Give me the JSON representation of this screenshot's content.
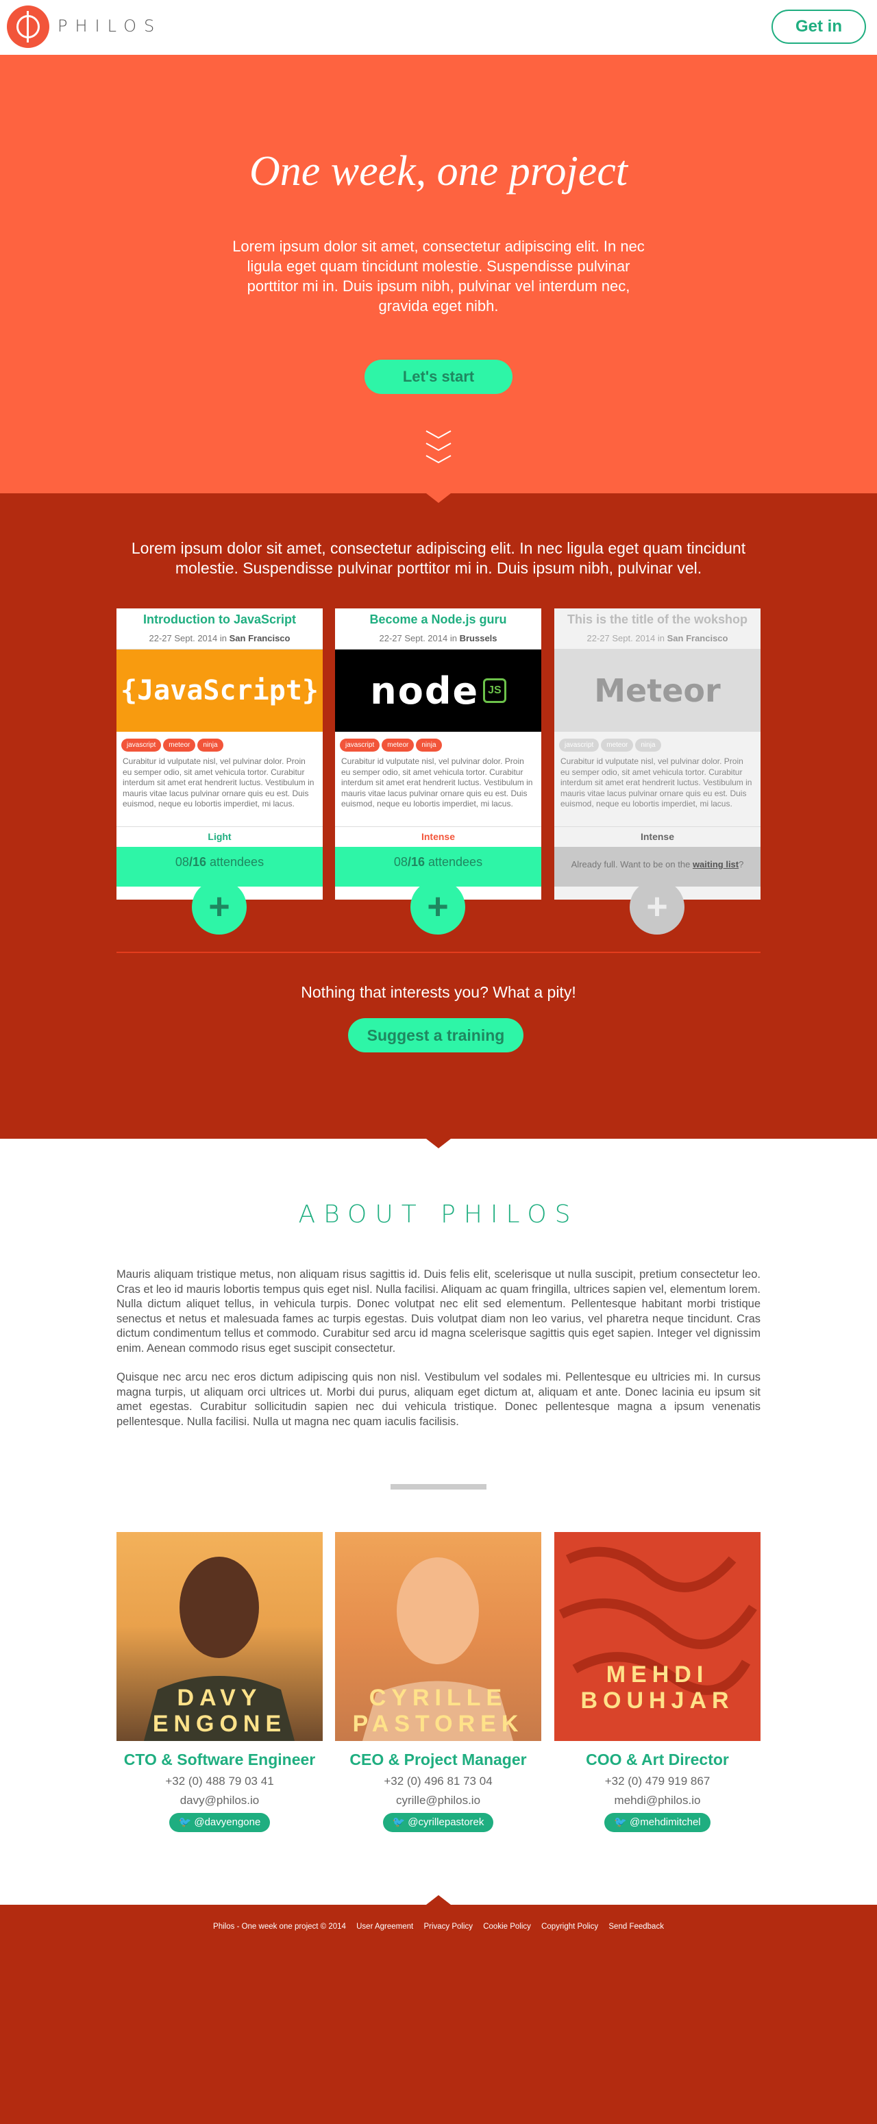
{
  "header": {
    "logo_text": "PHILOS",
    "cta": "Get in"
  },
  "hero": {
    "title": "One week, one project",
    "text": "Lorem ipsum dolor sit amet, consectetur adipiscing elit. In nec ligula eget quam tincidunt molestie. Suspendisse pulvinar porttitor mi in. Duis ipsum nibh, pulvinar vel interdum nec, gravida eget nibh.",
    "button": "Let's start"
  },
  "workshops": {
    "intro": "Lorem ipsum dolor sit amet, consectetur adipiscing elit. In nec ligula eget quam tincidunt molestie. Suspendisse pulvinar porttitor mi in. Duis ipsum nibh, pulvinar vel.",
    "cards": [
      {
        "title": "Introduction to JavaScript",
        "date": "22-27 Sept. 2014 in",
        "city": "San Francisco",
        "banner": "{JavaScript}",
        "tags": [
          "javascript",
          "meteor",
          "ninja"
        ],
        "desc": "Curabitur id vulputate nisl, vel pulvinar dolor. Proin eu semper odio, sit amet vehicula tortor. Curabitur interdum sit amet erat hendrerit luctus. Vestibulum in mauris vitae lacus pulvinar ornare quis eu est. Duis euismod, neque eu lobortis imperdiet, mi lacus.",
        "level": "Light",
        "level_color": "#1fae80",
        "count": "08",
        "total": "16",
        "attendees": " attendees",
        "plus": "+"
      },
      {
        "title": "Become a Node.js guru",
        "date": "22-27 Sept. 2014 in",
        "city": "Brussels",
        "banner": "node",
        "banner_badge": "JS",
        "tags": [
          "javascript",
          "meteor",
          "ninja"
        ],
        "desc": "Curabitur id vulputate nisl, vel pulvinar dolor. Proin eu semper odio, sit amet vehicula tortor. Curabitur interdum sit amet erat hendrerit luctus. Vestibulum in mauris vitae lacus pulvinar ornare quis eu est. Duis euismod, neque eu lobortis imperdiet, mi lacus.",
        "level": "Intense",
        "level_color": "#f2553a",
        "count": "08",
        "total": "16",
        "attendees": " attendees",
        "plus": "+"
      },
      {
        "title": "This is the title of the wokshop",
        "date": "22-27 Sept. 2014 in",
        "city": "San Francisco",
        "banner": "Meteor",
        "tags": [
          "javascript",
          "meteor",
          "ninja"
        ],
        "desc": "Curabitur id vulputate nisl, vel pulvinar dolor. Proin eu semper odio, sit amet vehicula tortor. Curabitur interdum sit amet erat hendrerit luctus. Vestibulum in mauris vitae lacus pulvinar ornare quis eu est. Duis euismod, neque eu lobortis imperdiet, mi lacus.",
        "level": "Intense",
        "full_text": "Already full.  Want to be on the ",
        "waiting_link": "waiting list",
        "full_end": "?",
        "plus": "+"
      }
    ],
    "pity": "Nothing that interests you? What a pity!",
    "suggest": "Suggest a training"
  },
  "about": {
    "title": "ABOUT PHILOS",
    "p1": "Mauris aliquam tristique metus, non aliquam risus sagittis id. Duis felis elit, scelerisque ut nulla suscipit, pretium consectetur leo. Cras et leo id mauris lobortis tempus quis eget nisl. Nulla facilisi. Aliquam ac quam fringilla, ultrices sapien vel, elementum lorem. Nulla dictum aliquet tellus, in vehicula turpis. Donec volutpat nec elit sed elementum. Pellentesque habitant morbi tristique senectus et netus et malesuada fames ac turpis egestas. Duis volutpat diam non leo varius, vel pharetra neque tincidunt. Cras dictum condimentum tellus et commodo. Curabitur sed arcu id magna scelerisque sagittis quis eget sapien. Integer vel dignissim enim. Aenean commodo risus eget suscipit consectetur.",
    "p2": "Quisque nec arcu nec eros dictum adipiscing quis non nisl. Vestibulum vel sodales mi. Pellentesque eu ultricies mi. In cursus magna turpis, ut aliquam orci ultrices ut. Morbi dui purus, aliquam eget dictum at, aliquam et ante. Donec lacinia eu ipsum sit amet egestas. Curabitur sollicitudin sapien nec dui vehicula tristique. Donec pellentesque magna a ipsum venenatis pellentesque. Nulla facilisi. Nulla ut magna nec quam iaculis facilisis."
  },
  "team": [
    {
      "first": "DAVY",
      "last": "ENGONE",
      "role": "CTO & Software Engineer",
      "phone": "+32 (0) 488 79 03 41",
      "email": "davy@philos.io",
      "twitter": "@davyengone"
    },
    {
      "first": "CYRILLE",
      "last": "PASTOREK",
      "role": "CEO & Project Manager",
      "phone": "+32 (0) 496 81 73 04",
      "email": "cyrille@philos.io",
      "twitter": "@cyrillepastorek"
    },
    {
      "first": "MEHDI",
      "last": "BOUHJAR",
      "role": "COO & Art Director",
      "phone": "+32 (0) 479 919 867",
      "email": "mehdi@philos.io",
      "twitter": "@mehdimitchel"
    }
  ],
  "footer": {
    "copyright": "Philos - One week one project © 2014",
    "links": [
      "User Agreement",
      "Privacy Policy",
      "Cookie Policy",
      "Copyright Policy",
      "Send Feedback"
    ]
  },
  "colors": {
    "accent": "#1fae80",
    "hero_bg": "#fe6340",
    "section_bg": "#b32b10",
    "mint": "#2ef5a7"
  }
}
